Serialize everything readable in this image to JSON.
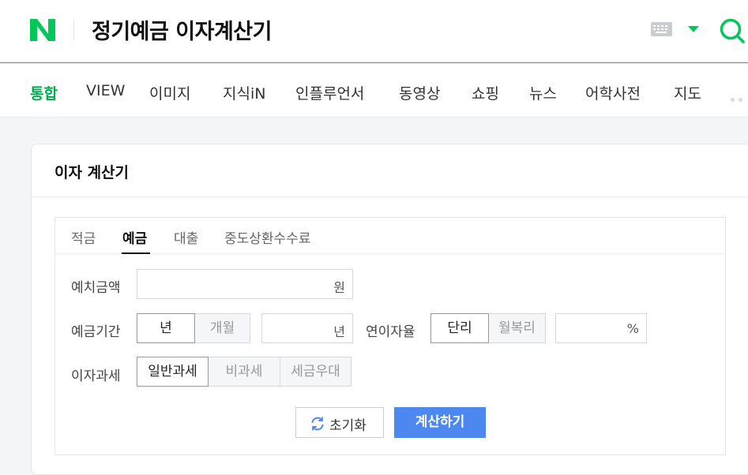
{
  "header": {
    "logo_letter": "N",
    "query": "정기예금 이자계산기",
    "brand_color": "#03c75a"
  },
  "nav": {
    "items": [
      {
        "label": "통합",
        "active": true
      },
      {
        "label": "VIEW"
      },
      {
        "label": "이미지"
      },
      {
        "label": "지식iN"
      },
      {
        "label": "인플루언서"
      },
      {
        "label": "동영상"
      },
      {
        "label": "쇼핑"
      },
      {
        "label": "뉴스"
      },
      {
        "label": "어학사전"
      },
      {
        "label": "지도"
      }
    ]
  },
  "calculator": {
    "title": "이자 계산기",
    "tabs": [
      {
        "label": "적금"
      },
      {
        "label": "예금",
        "active": true
      },
      {
        "label": "대출"
      },
      {
        "label": "중도상환수수료"
      }
    ],
    "deposit_amount": {
      "label": "예치금액",
      "value": "",
      "unit": "원"
    },
    "deposit_period": {
      "label": "예금기간",
      "options": [
        "년",
        "개월"
      ],
      "selected": "년",
      "value": "",
      "unit": "년"
    },
    "interest_rate": {
      "label": "연이자율",
      "options": [
        "단리",
        "월복리"
      ],
      "selected": "단리",
      "value": "",
      "unit": "%"
    },
    "tax": {
      "label": "이자과세",
      "options": [
        "일반과세",
        "비과세",
        "세금우대"
      ],
      "selected": "일반과세"
    },
    "reset_label": "초기화",
    "calc_label": "계산하기",
    "calc_color": "#4c88f0"
  }
}
